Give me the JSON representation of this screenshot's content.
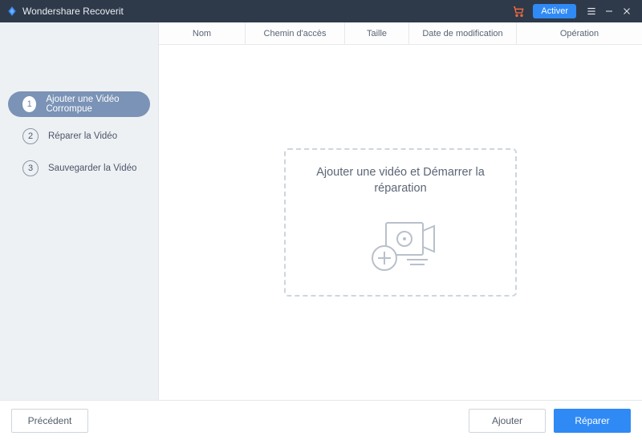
{
  "titlebar": {
    "app_name": "Wondershare Recoverit",
    "activate_label": "Activer"
  },
  "sidebar": {
    "steps": [
      {
        "num": "1",
        "label": "Ajouter une Vidéo Corrompue",
        "active": true
      },
      {
        "num": "2",
        "label": "Réparer la Vidéo",
        "active": false
      },
      {
        "num": "3",
        "label": "Sauvegarder la Vidéo",
        "active": false
      }
    ]
  },
  "table": {
    "headers": {
      "name": "Nom",
      "path": "Chemin d'accès",
      "size": "Taille",
      "date": "Date de modification",
      "op": "Opération"
    }
  },
  "dropzone": {
    "text": "Ajouter une vidéo et Démarrer la réparation"
  },
  "footer": {
    "prev": "Précédent",
    "add": "Ajouter",
    "repair": "Réparer"
  }
}
